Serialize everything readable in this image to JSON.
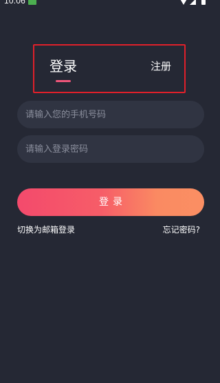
{
  "status_bar": {
    "time": "10:06",
    "app_icon": "app-notification-icon",
    "wifi_icon": "wifi-icon",
    "signal_icon": "cell-signal-icon",
    "battery_icon": "battery-icon"
  },
  "tabs": {
    "login_label": "登录",
    "register_label": "注册",
    "active": "login"
  },
  "form": {
    "phone_placeholder": "请输入您的手机号码",
    "phone_value": "",
    "password_placeholder": "请输入登录密码",
    "password_value": "",
    "login_button_label": "登录"
  },
  "links": {
    "switch_email": "切换为邮箱登录",
    "forgot_password": "忘记密码?"
  },
  "colors": {
    "background": "#252834",
    "field_background": "#303442",
    "accent_pink": "#f44a6c",
    "accent_orange": "#fb8f63",
    "highlight_border": "#e0202a"
  }
}
